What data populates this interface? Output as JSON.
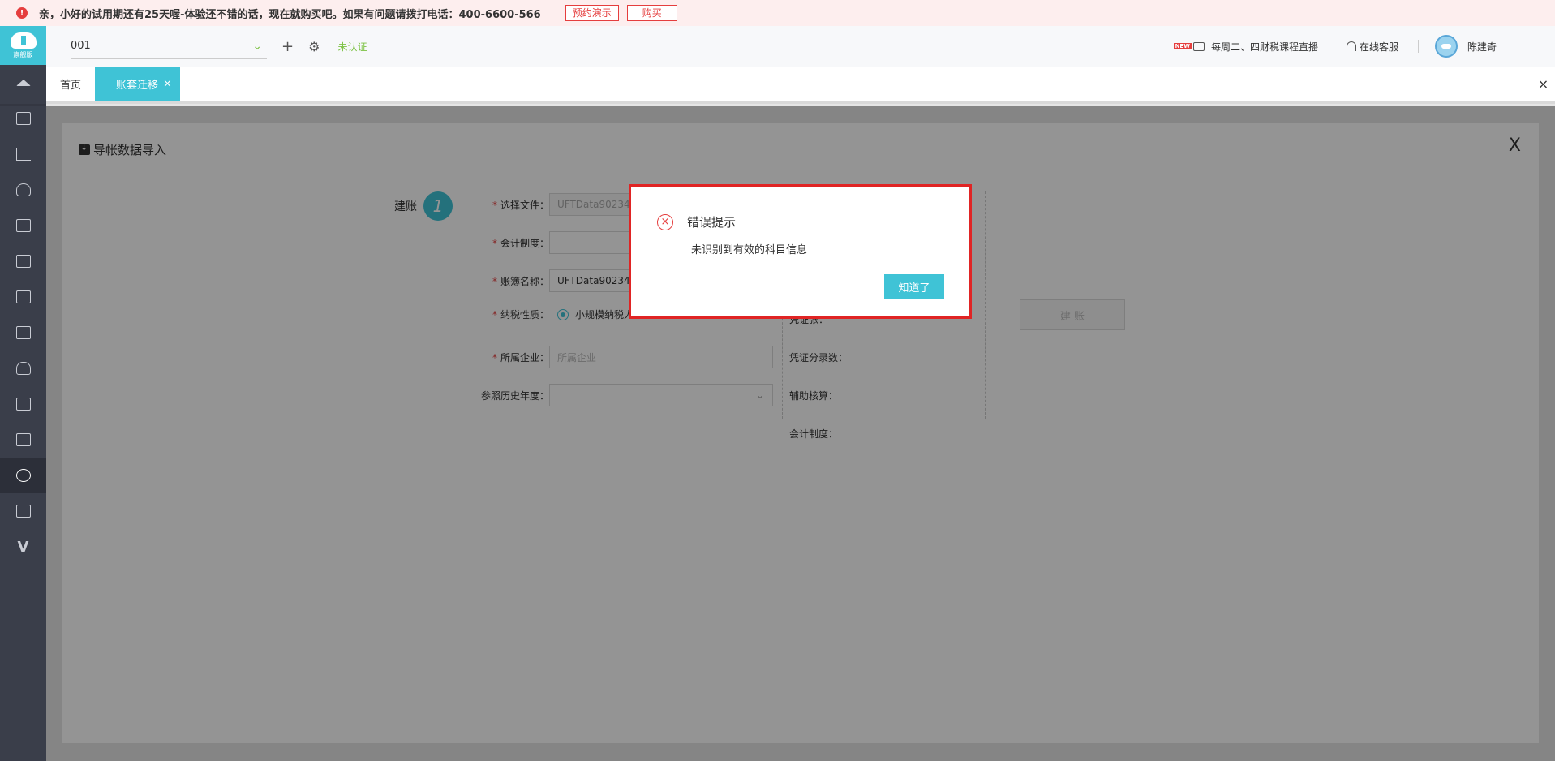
{
  "notice": {
    "message": "亲，小好的试用期还有25天喔-体验还不错的话，现在就购买吧。如果有问题请拨打电话：400-6600-566",
    "demo_btn": "预约演示",
    "buy_btn": "购买"
  },
  "sidebar": {
    "logo_text": "旗舰版",
    "items": [
      "home-icon",
      "voucher-icon",
      "report-chart-icon",
      "money-bag-icon",
      "ledger-icon",
      "analysis-icon",
      "invoice-icon",
      "assets-icon",
      "salary-icon",
      "tax-icon",
      "archive-icon",
      "settings-icon",
      "video-icon",
      "v-icon"
    ],
    "v_label": "V"
  },
  "header": {
    "company_value": "001",
    "unverified": "未认证",
    "live_badge": "NEW",
    "live_text": "每周二、四财税课程直播",
    "service_text": "在线客服",
    "user_name": "陈建奇"
  },
  "tabs": {
    "home": "首页",
    "active": "账套迁移",
    "active_close": "×",
    "close_all": "×"
  },
  "panel": {
    "title": "导帐数据导入",
    "close": "X",
    "step_label": "建账",
    "step_number": "1",
    "fields": {
      "file_label": "选择文件：",
      "file_value": "UFTData902343",
      "standard_label": "会计制度：",
      "name_label": "账簿名称：",
      "name_value": "UFTData902343_",
      "tax_label": "纳税性质：",
      "tax_option_selected": "小规模纳税人",
      "company_label": "所属企业：",
      "company_placeholder": "所属企业",
      "history_label": "参照历史年度："
    },
    "info": {
      "partial_label": "凭证张：",
      "voucher_entries": "凭证分录数：",
      "aux": "辅助核算：",
      "standard": "会计制度："
    },
    "build_btn": "建 账"
  },
  "dialog": {
    "icon": "×",
    "title": "错误提示",
    "message": "未识别到有效的科目信息",
    "ok": "知道了"
  },
  "colors": {
    "accent": "#3fc3d6",
    "error": "#e02424",
    "sidebar_bg": "#3a3e4a",
    "success": "#7cc243"
  }
}
